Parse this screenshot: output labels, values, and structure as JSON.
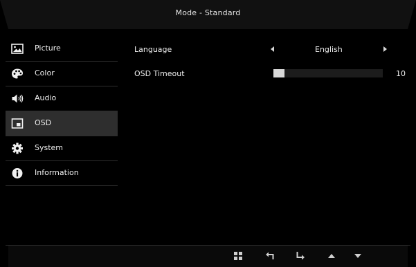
{
  "header": {
    "title": "Mode - Standard"
  },
  "sidebar": {
    "selected": "OSD",
    "items": [
      {
        "label": "Picture",
        "icon": "picture-icon"
      },
      {
        "label": "Color",
        "icon": "palette-icon"
      },
      {
        "label": "Audio",
        "icon": "speaker-icon"
      },
      {
        "label": "OSD",
        "icon": "osd-window-icon"
      },
      {
        "label": "System",
        "icon": "gear-icon"
      },
      {
        "label": "Information",
        "icon": "info-icon"
      }
    ]
  },
  "settings": {
    "language": {
      "label": "Language",
      "value": "English"
    },
    "osd_timeout": {
      "label": "OSD Timeout",
      "value": "10",
      "level_fraction": 0.1
    }
  },
  "footer": {
    "buttons": [
      "menu-grid-icon",
      "back-icon",
      "enter-icon",
      "up-arrow-icon",
      "down-arrow-icon"
    ]
  },
  "colors": {
    "background": "#000000",
    "selected_row": "#2e2e2e",
    "divider": "#2f2f2f",
    "text": "#f0f0f0"
  }
}
